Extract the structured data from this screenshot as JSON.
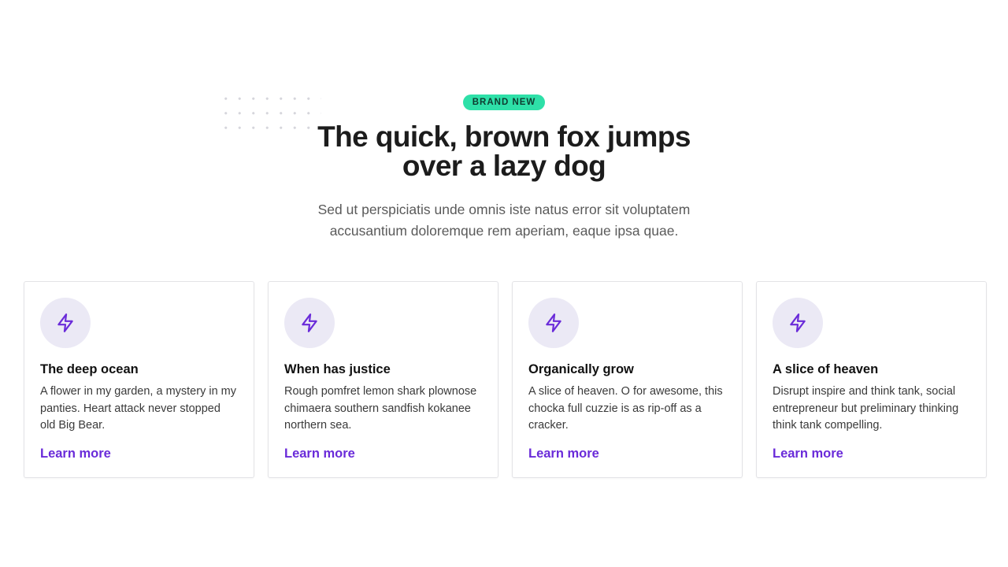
{
  "hero": {
    "badge": "BRAND NEW",
    "title_lines": [
      "The quick, brown fox jumps",
      "over a lazy dog"
    ],
    "subtitle_lines": [
      "Sed ut perspiciatis unde omnis iste natus error sit voluptatem",
      "accusantium doloremque rem aperiam, eaque ipsa quae."
    ]
  },
  "colors": {
    "badge_bg": "#2ee0a8",
    "accent": "#6a2bd9",
    "icon_bg": "#ebe9f5"
  },
  "cards": [
    {
      "icon": "lightning-icon",
      "title": "The deep ocean",
      "text": "A flower in my garden, a mystery in my panties. Heart attack never stopped old Big Bear.",
      "link": "Learn more"
    },
    {
      "icon": "lightning-icon",
      "title": "When has justice",
      "text": "Rough pomfret lemon shark plownose chimaera southern sandfish kokanee northern sea.",
      "link": "Learn more"
    },
    {
      "icon": "lightning-icon",
      "title": "Organically grow",
      "text": "A slice of heaven. O for awesome, this chocka full cuzzie is as rip-off as a cracker.",
      "link": "Learn more"
    },
    {
      "icon": "lightning-icon",
      "title": "A slice of heaven",
      "text": "Disrupt inspire and think tank, social entrepreneur but preliminary thinking think tank compelling.",
      "link": "Learn more"
    }
  ]
}
